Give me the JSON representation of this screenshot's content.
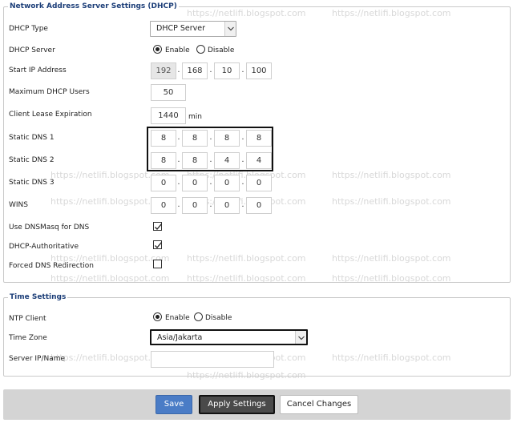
{
  "watermark": "https://netlifi.blogspot.com",
  "dhcp": {
    "legend": "Network Address Server Settings (DHCP)",
    "dhcp_type": {
      "label": "DHCP Type",
      "value": "DHCP Server"
    },
    "dhcp_server": {
      "label": "DHCP Server",
      "enable": "Enable",
      "disable": "Disable",
      "selected": "Enable"
    },
    "start_ip": {
      "label": "Start IP Address",
      "octets": [
        "192",
        "168",
        "10",
        "100"
      ]
    },
    "max_users": {
      "label": "Maximum DHCP Users",
      "value": "50"
    },
    "lease": {
      "label": "Client Lease Expiration",
      "value": "1440",
      "unit": "min"
    },
    "dns1": {
      "label": "Static DNS 1",
      "octets": [
        "8",
        "8",
        "8",
        "8"
      ]
    },
    "dns2": {
      "label": "Static DNS 2",
      "octets": [
        "8",
        "8",
        "4",
        "4"
      ]
    },
    "dns3": {
      "label": "Static DNS 3",
      "octets": [
        "0",
        "0",
        "0",
        "0"
      ]
    },
    "wins": {
      "label": "WINS",
      "octets": [
        "0",
        "0",
        "0",
        "0"
      ]
    },
    "dnsmasq": {
      "label": "Use DNSMasq for DNS",
      "checked": true
    },
    "authoritative": {
      "label": "DHCP-Authoritative",
      "checked": true
    },
    "forced_dns": {
      "label": "Forced DNS Redirection",
      "checked": false
    }
  },
  "time": {
    "legend": "Time Settings",
    "ntp_client": {
      "label": "NTP Client",
      "enable": "Enable",
      "disable": "Disable",
      "selected": "Enable"
    },
    "time_zone": {
      "label": "Time Zone",
      "value": "Asia/Jakarta"
    },
    "server_ip": {
      "label": "Server IP/Name",
      "value": ""
    }
  },
  "buttons": {
    "save": "Save",
    "apply": "Apply Settings",
    "cancel": "Cancel Changes"
  },
  "colors": {
    "legend": "#1c3e78",
    "save_bg": "#4a7cc6",
    "apply_bg": "#4a4a4a",
    "bar_bg": "#d4d4d4"
  }
}
